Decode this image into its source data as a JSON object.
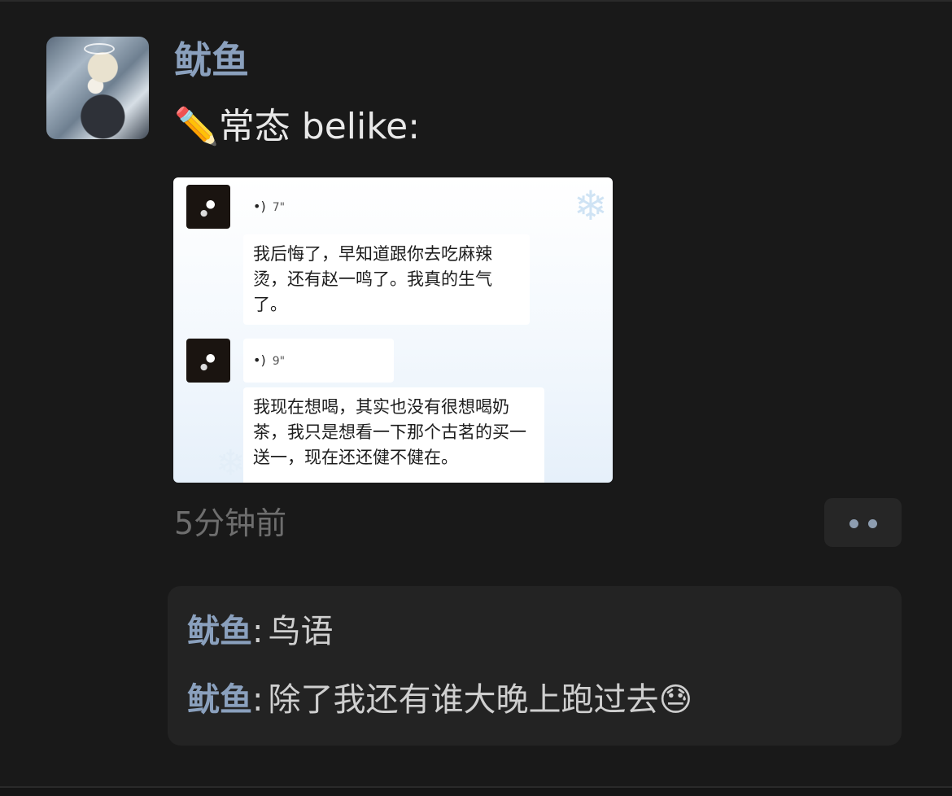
{
  "post": {
    "username": "鱿鱼",
    "text_emoji": "✏️",
    "text": "常态 belike:",
    "time": "5分钟前",
    "more_icon": "more-dots-icon"
  },
  "screenshot": {
    "messages": [
      {
        "voice_duration": "7\"",
        "text": "我后悔了，早知道跟你去吃麻辣烫，还有赵一鸣了。我真的生气了。"
      },
      {
        "voice_duration": "9\"",
        "text": "我现在想喝，其实也没有很想喝奶茶，我只是想看一下那个古茗的买一送一，现在还还健不健在。"
      }
    ]
  },
  "comments": [
    {
      "name": "鱿鱼",
      "colon": ":",
      "text": "鸟语"
    },
    {
      "name": "鱿鱼",
      "colon": ":",
      "text": "除了我还有谁大晚上跑过去😓"
    }
  ],
  "colors": {
    "background": "#191919",
    "name": "#8aa0bd",
    "comment_panel": "#232323"
  }
}
